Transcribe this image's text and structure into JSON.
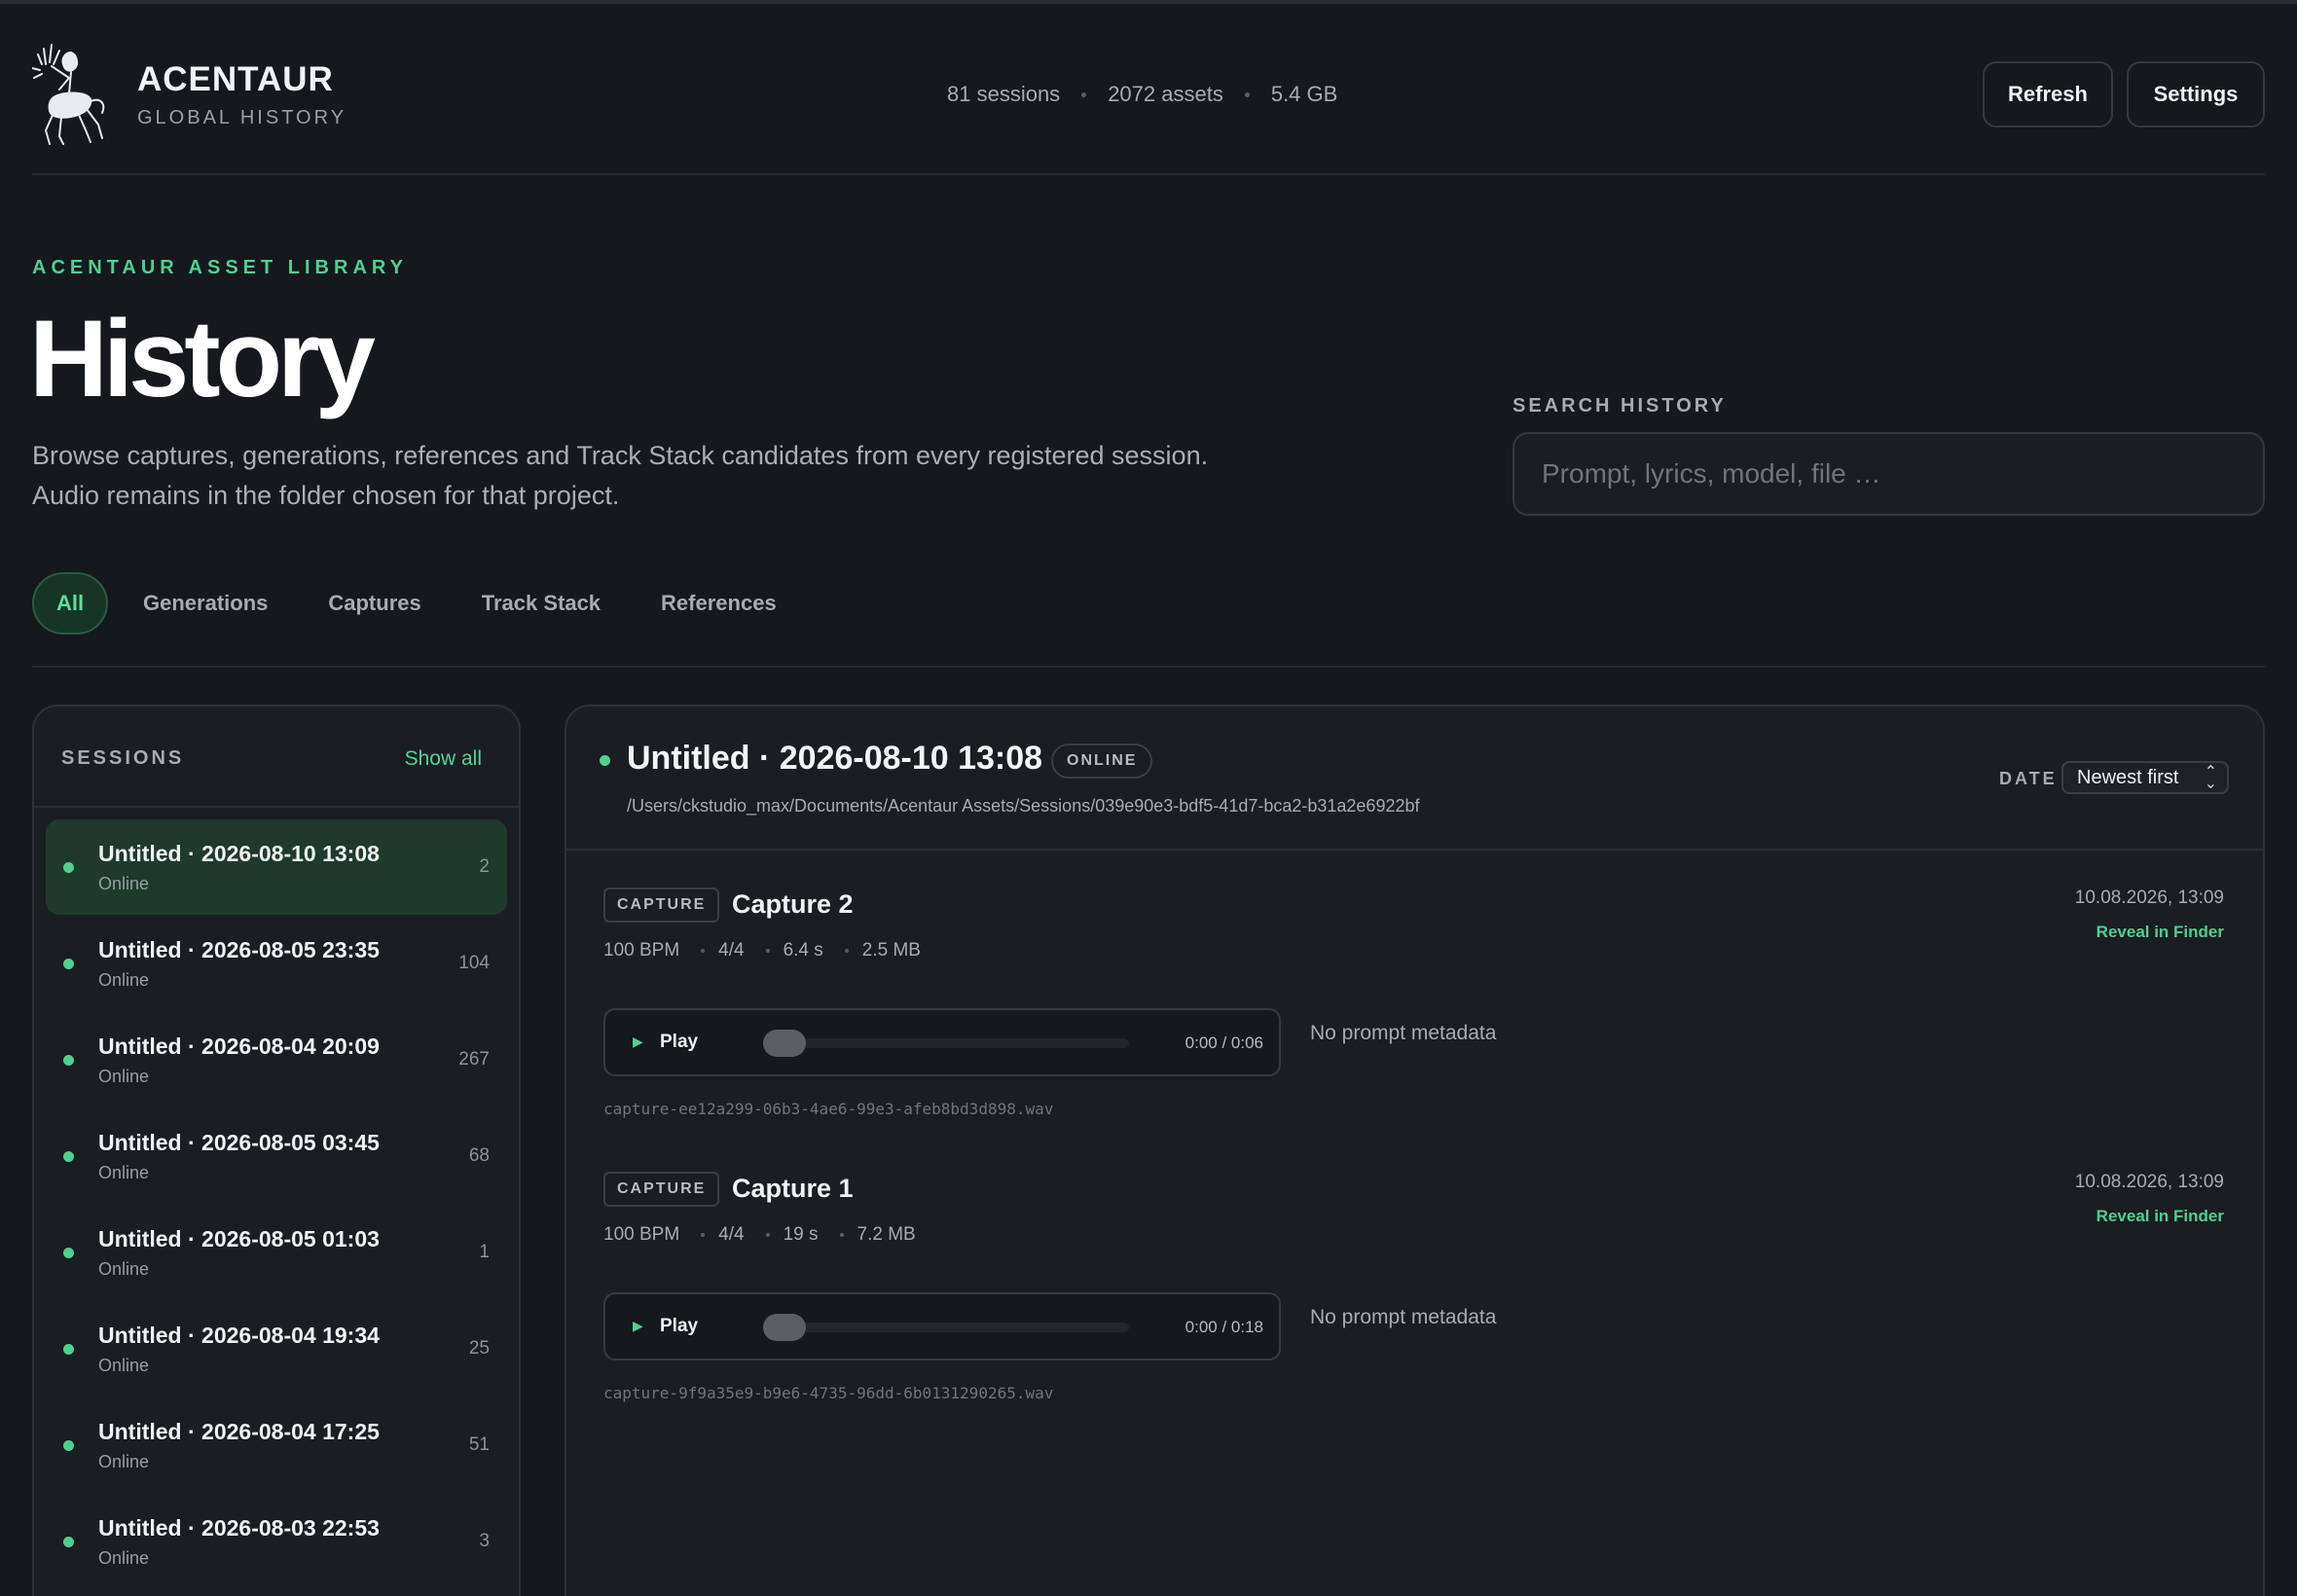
{
  "app": {
    "brand_title": "ACENTAUR",
    "brand_subtitle": "GLOBAL HISTORY",
    "stats": [
      "81 sessions",
      "2072 assets",
      "5.4 GB"
    ],
    "buttons": {
      "refresh": "Refresh",
      "settings": "Settings"
    }
  },
  "hero": {
    "eyebrow": "ACENTAUR ASSET LIBRARY",
    "title": "History",
    "description_line1": "Browse captures, generations, references and Track Stack candidates from every registered session.",
    "description_line2": "Audio remains in the folder chosen for that project."
  },
  "search": {
    "label": "SEARCH HISTORY",
    "placeholder": "Prompt, lyrics, model, file …",
    "value": ""
  },
  "tabs": [
    {
      "label": "All",
      "active": true
    },
    {
      "label": "Generations",
      "active": false
    },
    {
      "label": "Captures",
      "active": false
    },
    {
      "label": "Track Stack",
      "active": false
    },
    {
      "label": "References",
      "active": false
    }
  ],
  "sessions": {
    "title": "SESSIONS",
    "show_all": "Show all",
    "items": [
      {
        "name": "Untitled · 2026-08-10 13:08",
        "status": "Online",
        "count": "2",
        "active": true
      },
      {
        "name": "Untitled · 2026-08-05 23:35",
        "status": "Online",
        "count": "104",
        "active": false
      },
      {
        "name": "Untitled · 2026-08-04 20:09",
        "status": "Online",
        "count": "267",
        "active": false
      },
      {
        "name": "Untitled · 2026-08-05 03:45",
        "status": "Online",
        "count": "68",
        "active": false
      },
      {
        "name": "Untitled · 2026-08-05 01:03",
        "status": "Online",
        "count": "1",
        "active": false
      },
      {
        "name": "Untitled · 2026-08-04 19:34",
        "status": "Online",
        "count": "25",
        "active": false
      },
      {
        "name": "Untitled · 2026-08-04 17:25",
        "status": "Online",
        "count": "51",
        "active": false
      },
      {
        "name": "Untitled · 2026-08-03 22:53",
        "status": "Online",
        "count": "3",
        "active": false
      }
    ]
  },
  "detail": {
    "title": "Untitled · 2026-08-10 13:08",
    "badge": "ONLINE",
    "path": "/Users/ckstudio_max/Documents/Acentaur Assets/Sessions/039e90e3-bdf5-41d7-bca2-b31a2e6922bf",
    "date_label": "DATE",
    "sort_value": "Newest first",
    "assets": [
      {
        "tag": "CAPTURE",
        "name": "Capture 2",
        "bpm": "100 BPM",
        "meter": "4/4",
        "duration": "6.4 s",
        "size": "2.5 MB",
        "date": "10.08.2026, 13:09",
        "reveal": "Reveal in Finder",
        "play": "Play",
        "time": "0:00 / 0:06",
        "progress": 0,
        "prompt": "No prompt metadata",
        "file": "capture-ee12a299-06b3-4ae6-99e3-afeb8bd3d898.wav"
      },
      {
        "tag": "CAPTURE",
        "name": "Capture 1",
        "bpm": "100 BPM",
        "meter": "4/4",
        "duration": "19 s",
        "size": "7.2 MB",
        "date": "10.08.2026, 13:09",
        "reveal": "Reveal in Finder",
        "play": "Play",
        "time": "0:00 / 0:18",
        "progress": 0,
        "prompt": "No prompt metadata",
        "file": "capture-9f9a35e9-b9e6-4735-96dd-6b0131290265.wav"
      }
    ]
  },
  "colors": {
    "accent": "#4fd08f",
    "background": "#15181d",
    "panel": "#1a1d22"
  }
}
